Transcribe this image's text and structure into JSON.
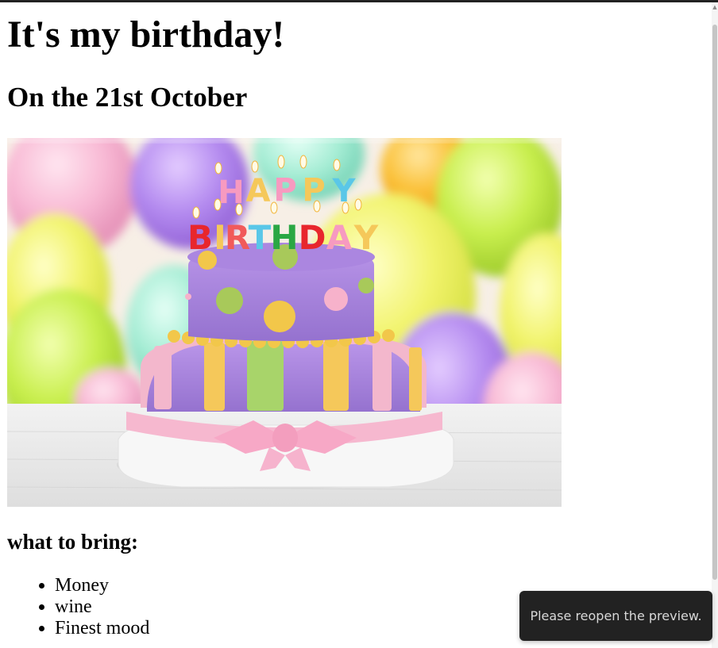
{
  "page": {
    "title": "It's my birthday!",
    "subtitle": "On the 21st October",
    "image_alt": "Birthday cake",
    "cake_topper": "HAPPY BIRTHDAY"
  },
  "bring": {
    "heading": "what to bring:",
    "items": [
      "Money",
      "wine",
      "Finest mood"
    ]
  },
  "toast": {
    "message": "Please reopen the preview."
  },
  "colors": {
    "toast_bg": "#222222",
    "top_bar": "#222222"
  },
  "icons": {
    "scrollbar_up": "scroll-up-arrow-icon"
  }
}
